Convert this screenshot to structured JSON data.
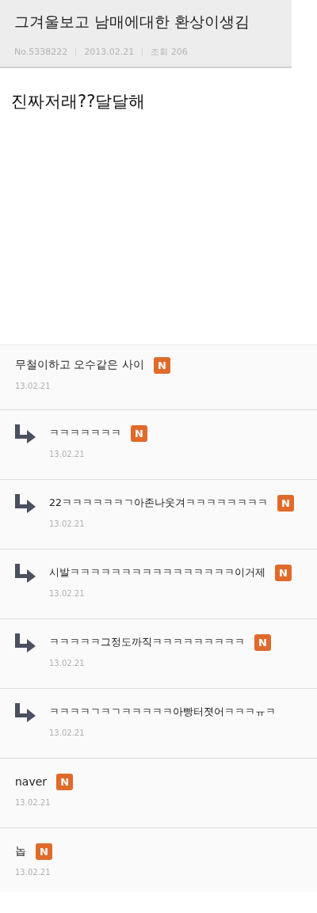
{
  "header": {
    "title": "그겨울보고 남매에대한 환상이생김",
    "meta": [
      "No.5338222",
      "2013.02.21",
      "조회 206"
    ]
  },
  "body": "진짜저래??달달해",
  "comments": [
    {
      "kind": "comment",
      "text": "무철이하고 오수같은 사이",
      "badge": "N",
      "date": "13.02.21"
    },
    {
      "kind": "reply",
      "text": "ㅋㅋㅋㅋㅋㅋㅋ",
      "badge": "N",
      "date": "13.02.21"
    },
    {
      "kind": "reply",
      "text": "22ㅋㅋㅋㅋㅋㅋㄱ아존나웃겨ㅋㅋㅋㅋㅋㅋㅋㅋ",
      "badge": "N",
      "date": "13.02.21"
    },
    {
      "kind": "reply",
      "text": "시발ㅋㅋㅋㅋㅋㅋㅋㅋㅋㅋㅋㅋㅋㅋㅋㅋ이거제",
      "badge": "N",
      "date": "13.02.21"
    },
    {
      "kind": "reply",
      "text": "ㅋㅋㅋㅋㅋ그정도까직ㅋㅋㅋㅋㅋㅋㅋㅋㅋ",
      "badge": "N",
      "date": "13.02.21"
    },
    {
      "kind": "reply",
      "text": "ㅋㅋㅋㅋㄱㅋㄱㅋㅋㅋㅋㅋ아빵터졋어ㅋㅋㅋㅠㅋ",
      "date": "13.02.21"
    },
    {
      "kind": "comment",
      "text": "naver",
      "badge": "N",
      "date": "13.02.21"
    },
    {
      "kind": "comment",
      "text": "놉",
      "badge": "N",
      "date": "13.02.21"
    }
  ]
}
